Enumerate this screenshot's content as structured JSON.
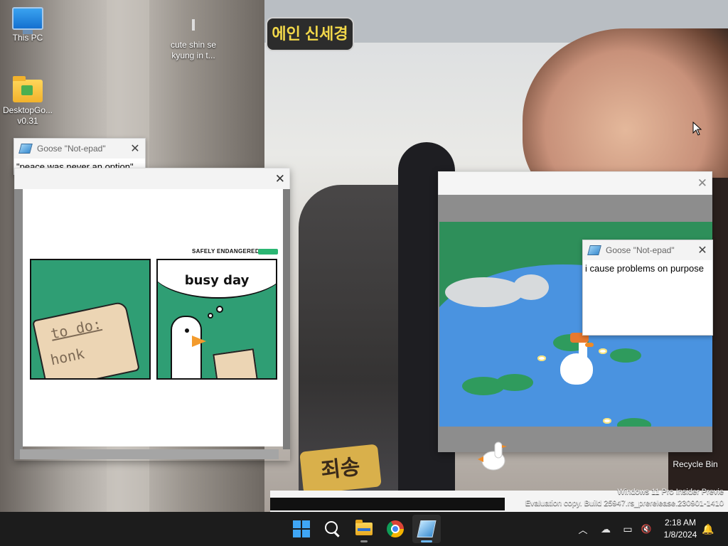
{
  "desktop": {
    "icons": [
      {
        "label": "This PC",
        "icon": "monitor-icon"
      },
      {
        "label": "cute shin se kyung in t...",
        "icon": "image-thumbnail-icon"
      },
      {
        "label": "DesktopGo... v0.31",
        "icon": "folder-icon"
      },
      {
        "label": "Recycle Bin",
        "icon": "recycle-bin-icon"
      }
    ],
    "wallpaper_text": {
      "top_sign": "에인 신세경",
      "bottom_sign": "죄송"
    },
    "watermark": {
      "line1": "Windows 11 Pro Insider Previe",
      "line2": "Evaluation copy. Build 25947.rs_prerelease.230901-1410"
    }
  },
  "notepad_windows": [
    {
      "title": "Goose \"Not-epad\"",
      "text": "\"peace was never an option\"",
      "close": "✕"
    },
    {
      "title": "Goose \"Not-epad\"",
      "text": "i cause problems on purpose",
      "close": "✕"
    }
  ],
  "meme_window": {
    "close": "✕",
    "credit": "SAFELY ENDANGERED",
    "panel1_text_line1": "to do:",
    "panel1_text_line2": "honk",
    "panel2_caption": "busy day"
  },
  "game_window": {
    "close": "✕"
  },
  "taskbar": {
    "apps": [
      {
        "name": "Start",
        "icon": "windows-logo-icon"
      },
      {
        "name": "Search",
        "icon": "search-icon"
      },
      {
        "name": "File Explorer",
        "icon": "folder-icon"
      },
      {
        "name": "Google Chrome",
        "icon": "chrome-icon"
      },
      {
        "name": "Notepad",
        "icon": "notepad-icon"
      }
    ],
    "tray": {
      "chevron": "︿",
      "onedrive": "☁",
      "network": "▭",
      "volume": "🔇",
      "notifications": "🔔"
    },
    "clock": {
      "time": "2:18 AM",
      "date": "1/8/2024"
    }
  },
  "colors": {
    "taskbar": "#1c1c1c",
    "accent": "#3fa6f5",
    "meme_green": "#2f9e74",
    "pond_blue": "#4a93e0"
  }
}
